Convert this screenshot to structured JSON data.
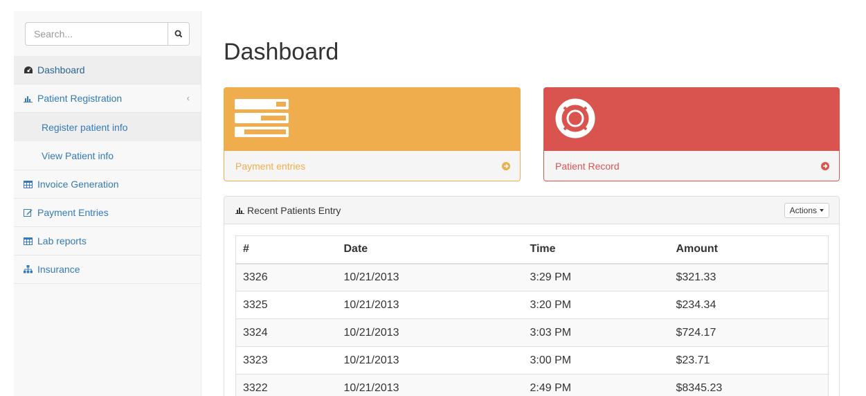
{
  "search": {
    "placeholder": "Search..."
  },
  "sidebar": {
    "items": [
      {
        "label": "Dashboard",
        "icon": "dashboard-icon"
      },
      {
        "label": "Patient Registration",
        "icon": "bar-chart-icon"
      },
      {
        "label": "Register patient info"
      },
      {
        "label": "View Patient info"
      },
      {
        "label": "Invoice Generation",
        "icon": "table-icon"
      },
      {
        "label": "Payment Entries",
        "icon": "edit-icon"
      },
      {
        "label": "Lab reports",
        "icon": "table-icon"
      },
      {
        "label": "Insurance",
        "icon": "sitemap-icon"
      }
    ]
  },
  "main": {
    "title": "Dashboard",
    "cards": [
      {
        "label": "Payment entries",
        "color": "#f0ad4e",
        "icon": "tasks-icon"
      },
      {
        "label": "Patient Record",
        "color": "#d9534f",
        "icon": "life-ring-icon"
      }
    ],
    "table_panel": {
      "title": "Recent Patients Entry",
      "actions_label": "Actions",
      "columns": [
        "#",
        "Date",
        "Time",
        "Amount"
      ],
      "rows": [
        [
          "3326",
          "10/21/2013",
          "3:29 PM",
          "$321.33"
        ],
        [
          "3325",
          "10/21/2013",
          "3:20 PM",
          "$234.34"
        ],
        [
          "3324",
          "10/21/2013",
          "3:03 PM",
          "$724.17"
        ],
        [
          "3323",
          "10/21/2013",
          "3:00 PM",
          "$23.71"
        ],
        [
          "3322",
          "10/21/2013",
          "2:49 PM",
          "$8345.23"
        ]
      ]
    }
  }
}
